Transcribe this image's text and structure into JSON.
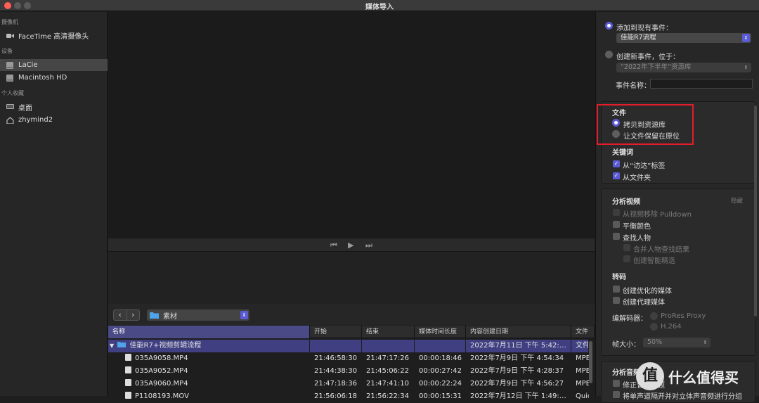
{
  "window": {
    "title": "媒体导入"
  },
  "sidebar": {
    "sections": [
      {
        "header": "摄像机",
        "items": [
          {
            "label": "FaceTime 高清摄像头",
            "icon": "camera-icon"
          }
        ]
      },
      {
        "header": "设备",
        "items": [
          {
            "label": "LaCie",
            "icon": "drive-icon",
            "selected": true
          },
          {
            "label": "Macintosh HD",
            "icon": "drive-icon"
          }
        ]
      },
      {
        "header": "个人收藏",
        "items": [
          {
            "label": "桌面",
            "icon": "desktop-icon"
          },
          {
            "label": "zhymind2",
            "icon": "home-icon"
          }
        ]
      }
    ]
  },
  "browser": {
    "folder": "素材",
    "columns": [
      "名称",
      "开始",
      "结束",
      "媒体时间长度",
      "内容创建日期",
      "文件"
    ],
    "rows": [
      {
        "name": "佳能R7+视频剪辑流程",
        "start": "",
        "end": "",
        "duration": "",
        "created": "2022年7月11日 下午 5:42:…",
        "type": "文件",
        "folder": true
      },
      {
        "name": "035A9058.MP4",
        "start": "21:46:58:30",
        "end": "21:47:17:26",
        "duration": "00:00:18:46",
        "created": "2022年7月9日 下午 4:54:34",
        "type": "MPE"
      },
      {
        "name": "035A9052.MP4",
        "start": "21:44:38:30",
        "end": "21:45:06:22",
        "duration": "00:00:27:42",
        "created": "2022年7月9日 下午 4:28:37",
        "type": "MPE"
      },
      {
        "name": "035A9060.MP4",
        "start": "21:47:18:36",
        "end": "21:47:41:10",
        "duration": "00:00:22:24",
        "created": "2022年7月9日 下午 4:56:27",
        "type": "MPE"
      },
      {
        "name": "P1108193.MOV",
        "start": "21:56:06:18",
        "end": "21:56:22:34",
        "duration": "00:00:15:31",
        "created": "2022年7月12日 下午 1:49:…",
        "type": "Quic"
      }
    ]
  },
  "import": {
    "add_existing": "添加到现有事件：",
    "existing_event": "佳能R7流程",
    "create_new": "创建新事件，位于：",
    "new_event_library": "“2022年下半年”资源库",
    "event_name_label": "事件名称：",
    "files_header": "文件",
    "copy_to_library": "拷贝到资源库",
    "leave_in_place": "让文件保留在原位",
    "keywords_header": "关键词",
    "from_finder_tags": "从“访达”标签",
    "from_folders": "从文件夹",
    "analyze_video_header": "分析视频",
    "hide": "隐藏",
    "remove_pulldown": "从视频移除 Pulldown",
    "balance_color": "平衡颜色",
    "find_people": "查找人物",
    "consolidate_people": "合并人物查找结果",
    "create_smart_collections": "创建智能精选",
    "transcode_header": "转码",
    "create_optimized": "创建优化的媒体",
    "create_proxy": "创建代理媒体",
    "codec_label": "编解码器：",
    "codec_prores": "ProRes Proxy",
    "codec_h264": "H.264",
    "frame_size_label": "帧大小：",
    "frame_size": "50%",
    "analyze_audio_header": "分析音频",
    "fix_audio": "修正音频问题",
    "separate_mono": "将单声道隔开并对立体声音频进行分组"
  },
  "watermark": {
    "logo": "值",
    "text": "什么值得买"
  },
  "colors": {
    "accent": "#5b5bd6",
    "highlight_box": "#e41c2c"
  }
}
